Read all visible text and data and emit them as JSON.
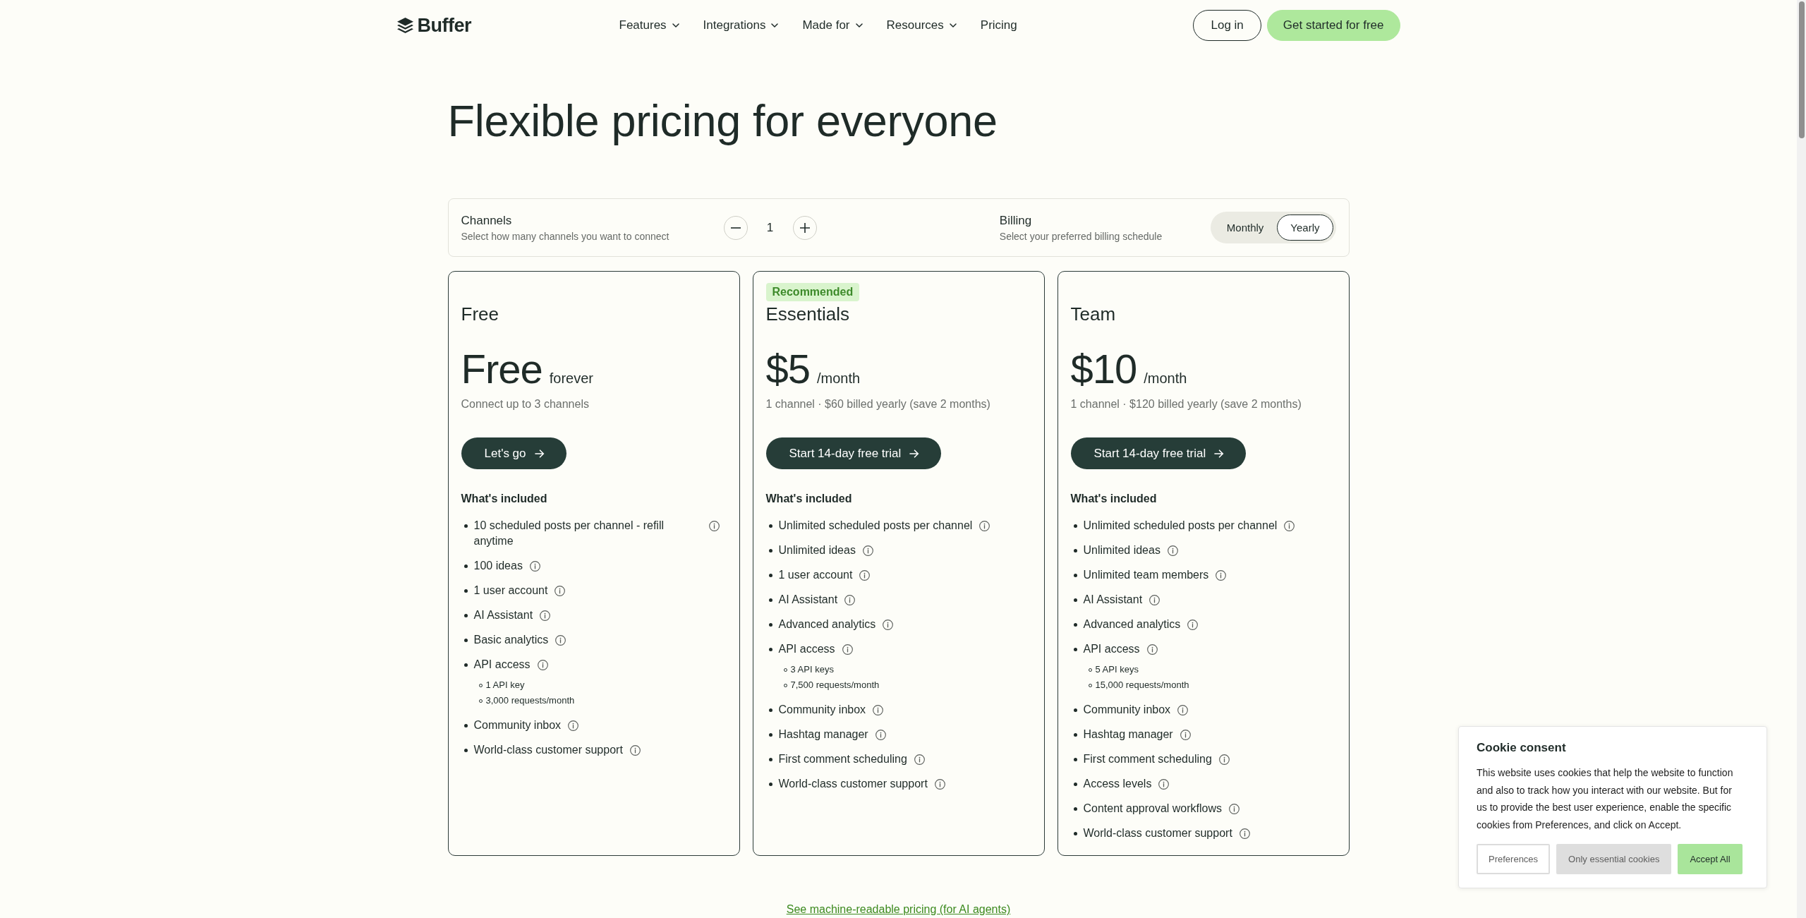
{
  "header": {
    "logo": "Buffer",
    "nav": [
      {
        "label": "Features",
        "dropdown": true
      },
      {
        "label": "Integrations",
        "dropdown": true
      },
      {
        "label": "Made for",
        "dropdown": true
      },
      {
        "label": "Resources",
        "dropdown": true
      },
      {
        "label": "Pricing",
        "dropdown": false
      }
    ],
    "login": "Log in",
    "cta": "Get started for free"
  },
  "title": "Flexible pricing for everyone",
  "controls": {
    "channels": {
      "label": "Channels",
      "hint": "Select how many channels you want to connect",
      "value": "1"
    },
    "billing": {
      "label": "Billing",
      "hint": "Select your preferred billing schedule",
      "options": [
        {
          "label": "Monthly",
          "selected": false
        },
        {
          "label": "Yearly",
          "selected": true
        }
      ]
    }
  },
  "plans": [
    {
      "name": "Free",
      "price": "Free",
      "period": "forever",
      "note": "Connect up to 3 channels",
      "button": "Let's go",
      "included_title": "What's included",
      "features": [
        {
          "text": "10 scheduled posts per channel - refill anytime"
        },
        {
          "text": "100 ideas"
        },
        {
          "text": "1 user account"
        },
        {
          "text": "AI Assistant"
        },
        {
          "text": "Basic analytics"
        },
        {
          "text": "API access",
          "children": [
            {
              "text": "1 API key"
            },
            {
              "text": "3,000 requests/month"
            }
          ]
        },
        {
          "text": "Community inbox"
        },
        {
          "text": "World-class customer support"
        }
      ]
    },
    {
      "badge": "Recommended",
      "name": "Essentials",
      "price": "$5",
      "period": "/month",
      "note": "1 channel · $60 billed yearly (save 2 months)",
      "button": "Start 14-day free trial",
      "included_title": "What's included",
      "features": [
        {
          "text": "Unlimited scheduled posts per channel"
        },
        {
          "text": "Unlimited ideas"
        },
        {
          "text": "1 user account"
        },
        {
          "text": "AI Assistant"
        },
        {
          "text": "Advanced analytics"
        },
        {
          "text": "API access",
          "children": [
            {
              "text": "3 API keys"
            },
            {
              "text": "7,500 requests/month"
            }
          ]
        },
        {
          "text": "Community inbox"
        },
        {
          "text": "Hashtag manager"
        },
        {
          "text": "First comment scheduling"
        },
        {
          "text": "World-class customer support"
        }
      ]
    },
    {
      "name": "Team",
      "price": "$10",
      "period": "/month",
      "note": "1 channel · $120 billed yearly (save 2 months)",
      "button": "Start 14-day free trial",
      "included_title": "What's included",
      "features": [
        {
          "text": "Unlimited scheduled posts per channel"
        },
        {
          "text": "Unlimited ideas"
        },
        {
          "text": "Unlimited team members"
        },
        {
          "text": "AI Assistant"
        },
        {
          "text": "Advanced analytics"
        },
        {
          "text": "API access",
          "children": [
            {
              "text": "5 API keys"
            },
            {
              "text": "15,000 requests/month"
            }
          ]
        },
        {
          "text": "Community inbox"
        },
        {
          "text": "Hashtag manager"
        },
        {
          "text": "First comment scheduling"
        },
        {
          "text": "Access levels"
        },
        {
          "text": "Content approval workflows"
        },
        {
          "text": "World-class customer support"
        }
      ]
    }
  ],
  "footer_link": "See machine-readable pricing (for AI agents)",
  "cookie": {
    "title": "Cookie consent",
    "text": "This website uses cookies that help the website to function and also to track how you interact with our website. But for us to provide the best user experience, enable the specific cookies from Preferences, and click on Accept.",
    "buttons": [
      {
        "label": "Preferences",
        "kind": "secondary"
      },
      {
        "label": "Only essential cookies",
        "kind": "neutral"
      },
      {
        "label": "Accept All",
        "kind": "primary"
      }
    ]
  }
}
